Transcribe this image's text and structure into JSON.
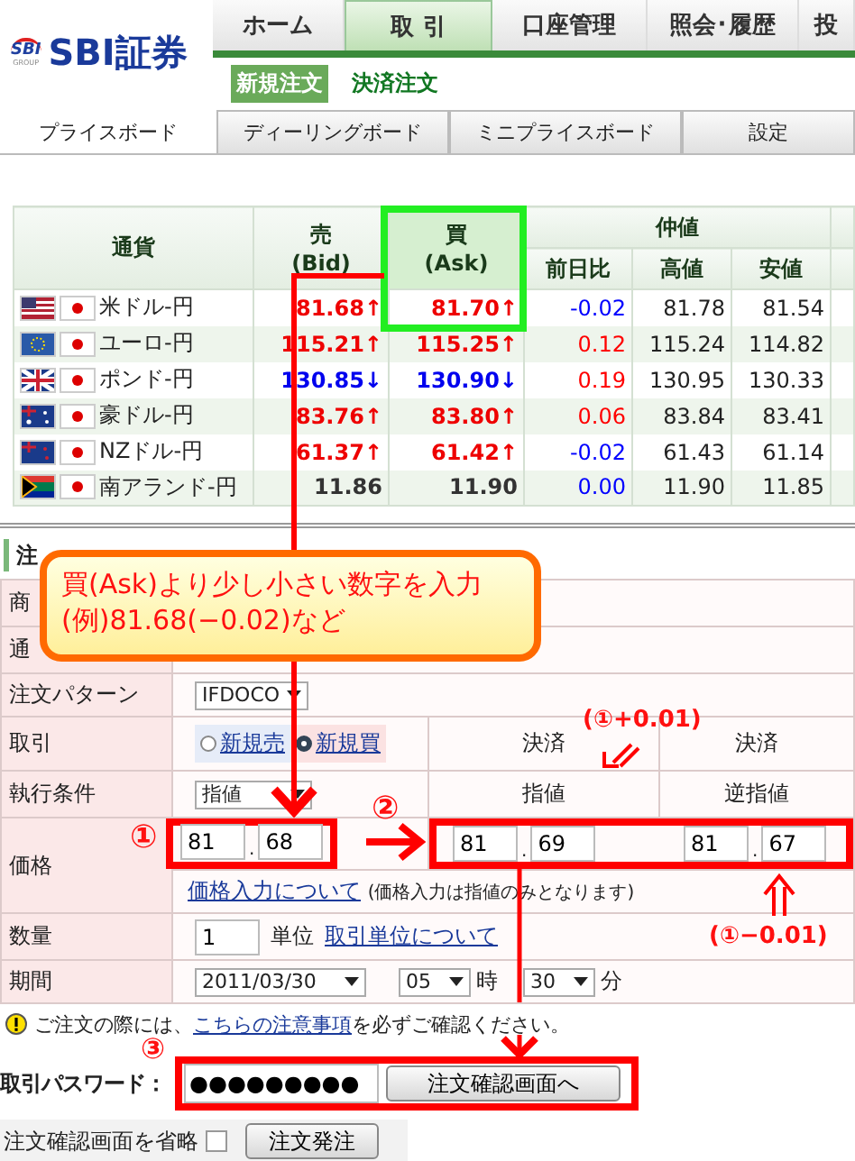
{
  "logo": {
    "mark": "SBI",
    "mark_sub": "GROUP",
    "name": "SBI証券"
  },
  "nav_tabs": [
    {
      "label": "ホーム",
      "selected": false
    },
    {
      "label": "取 引",
      "selected": true
    },
    {
      "label": "口座管理",
      "selected": false
    },
    {
      "label": "照会･履歴",
      "selected": false
    },
    {
      "label": "投",
      "selected": false
    }
  ],
  "sub_nav": [
    {
      "label": "新規注文",
      "selected": true
    },
    {
      "label": "決済注文",
      "selected": false
    }
  ],
  "board_tabs": [
    {
      "label": "プライスボード",
      "selected": true
    },
    {
      "label": "ディーリングボード",
      "selected": false
    },
    {
      "label": "ミニプライスボード",
      "selected": false
    },
    {
      "label": "設定",
      "selected": false
    }
  ],
  "price_table": {
    "columns": {
      "currency": "通貨",
      "bid": [
        "売",
        "(Bid)"
      ],
      "ask": [
        "買",
        "(Ask)"
      ],
      "mid": "仲値",
      "change": "前日比",
      "high": "高値",
      "low": "安値"
    },
    "rows": [
      {
        "kind": "us",
        "pair": "米ドル-円",
        "bid": {
          "text": "81.68↑",
          "color": "#ee0000"
        },
        "ask": {
          "text": "81.70↑",
          "color": "#ee0000"
        },
        "change": {
          "text": "-0.02",
          "color": "#0000ff"
        },
        "high": "81.78",
        "low": "81.54"
      },
      {
        "kind": "eu",
        "pair": "ユーロ-円",
        "bid": {
          "text": "115.21↑",
          "color": "#ee0000"
        },
        "ask": {
          "text": "115.25↑",
          "color": "#ee0000"
        },
        "change": {
          "text": "0.12",
          "color": "#ff0000"
        },
        "high": "115.24",
        "low": "114.82"
      },
      {
        "kind": "uk",
        "pair": "ポンド-円",
        "bid": {
          "text": "130.85↓",
          "color": "#0000ee"
        },
        "ask": {
          "text": "130.90↓",
          "color": "#0000ee"
        },
        "change": {
          "text": "0.19",
          "color": "#ff0000"
        },
        "high": "130.95",
        "low": "130.33"
      },
      {
        "kind": "au",
        "pair": "豪ドル-円",
        "bid": {
          "text": "83.76↑",
          "color": "#ee0000"
        },
        "ask": {
          "text": "83.80↑",
          "color": "#ee0000"
        },
        "change": {
          "text": "0.06",
          "color": "#ff0000"
        },
        "high": "83.84",
        "low": "83.41"
      },
      {
        "kind": "nz",
        "pair": "NZドル-円",
        "bid": {
          "text": "61.37↑",
          "color": "#ee0000"
        },
        "ask": {
          "text": "61.42↑",
          "color": "#ee0000"
        },
        "change": {
          "text": "-0.02",
          "color": "#0000ff"
        },
        "high": "61.43",
        "low": "61.14"
      },
      {
        "kind": "za",
        "pair": "南アランド-円",
        "bid": {
          "text": "11.86",
          "color": "#333333"
        },
        "ask": {
          "text": "11.90",
          "color": "#333333"
        },
        "change": {
          "text": "0.00",
          "color": "#0000ff"
        },
        "high": "11.90",
        "low": "11.85"
      }
    ]
  },
  "order_form": {
    "title": "注",
    "product_label": "商",
    "currency_label": "通",
    "pattern": {
      "label": "注文パターン",
      "value": "IFDOCO"
    },
    "trade": {
      "label": "取引",
      "options": [
        {
          "label": "新規売",
          "selected": false
        },
        {
          "label": "新規買",
          "selected": true
        }
      ],
      "settle_headers": [
        "決済",
        "決済"
      ]
    },
    "execution": {
      "label": "執行条件",
      "value": "指値",
      "settle": [
        "指値",
        "逆指値"
      ]
    },
    "price": {
      "label": "価格",
      "fields": [
        {
          "integer": "81",
          "separator": ".",
          "fraction": "68"
        },
        {
          "integer": "81",
          "separator": ".",
          "fraction": "69"
        },
        {
          "integer": "81",
          "separator": ".",
          "fraction": "67"
        }
      ],
      "help_link": "価格入力について",
      "note": "(価格入力は指値のみとなります)"
    },
    "quantity": {
      "label": "数量",
      "value": "1",
      "unit": "単位",
      "link": "取引単位について"
    },
    "period": {
      "label": "期間",
      "date": "2011/03/30",
      "hour": "05",
      "hour_unit": "時",
      "minute": "30",
      "minute_unit": "分"
    }
  },
  "notice": {
    "before": "ご注文の際には、",
    "link": "こちらの注意事項",
    "after": "を必ずご確認ください。"
  },
  "password": {
    "label": "取引パスワード：",
    "value": "●●●●●●●●●",
    "button": "注文確認画面へ"
  },
  "skip": {
    "label": "注文確認画面を省略",
    "checked": false,
    "button": "注文発注"
  },
  "annotations": {
    "callout": [
      "買(Ask)より少し小さい数字を入力",
      "(例)81.68(−0.02)など"
    ],
    "markers": [
      "①",
      "②",
      "③"
    ],
    "plus_note": "(①+0.01)",
    "minus_note": "(①−0.01)"
  }
}
